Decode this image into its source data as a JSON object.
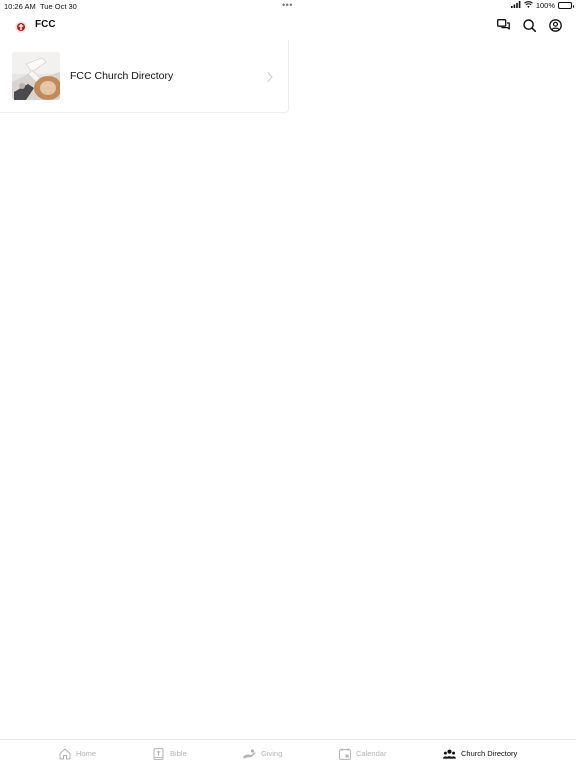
{
  "status_bar": {
    "time": "10:26 AM",
    "date": "Tue Oct 30",
    "battery": "100%",
    "battery_level": 1.0
  },
  "header": {
    "title": "FCC",
    "icons": [
      "chat-icon",
      "search-icon",
      "profile-icon"
    ]
  },
  "list": {
    "items": [
      {
        "label": "FCC Church Directory",
        "icon": "photo-thumbnail"
      }
    ]
  },
  "tab_bar": {
    "tabs": [
      {
        "label": "Home",
        "icon": "home-icon",
        "active": false
      },
      {
        "label": "Bible",
        "icon": "bible-icon",
        "active": false
      },
      {
        "label": "Giving",
        "icon": "giving-icon",
        "active": false
      },
      {
        "label": "Calendar",
        "icon": "calendar-icon",
        "active": false
      },
      {
        "label": "Church Directory",
        "icon": "people-icon",
        "active": true
      }
    ]
  },
  "colors": {
    "active_tab": "#111111",
    "inactive_tab": "#b3b3b3",
    "logo_red": "#b32025"
  }
}
